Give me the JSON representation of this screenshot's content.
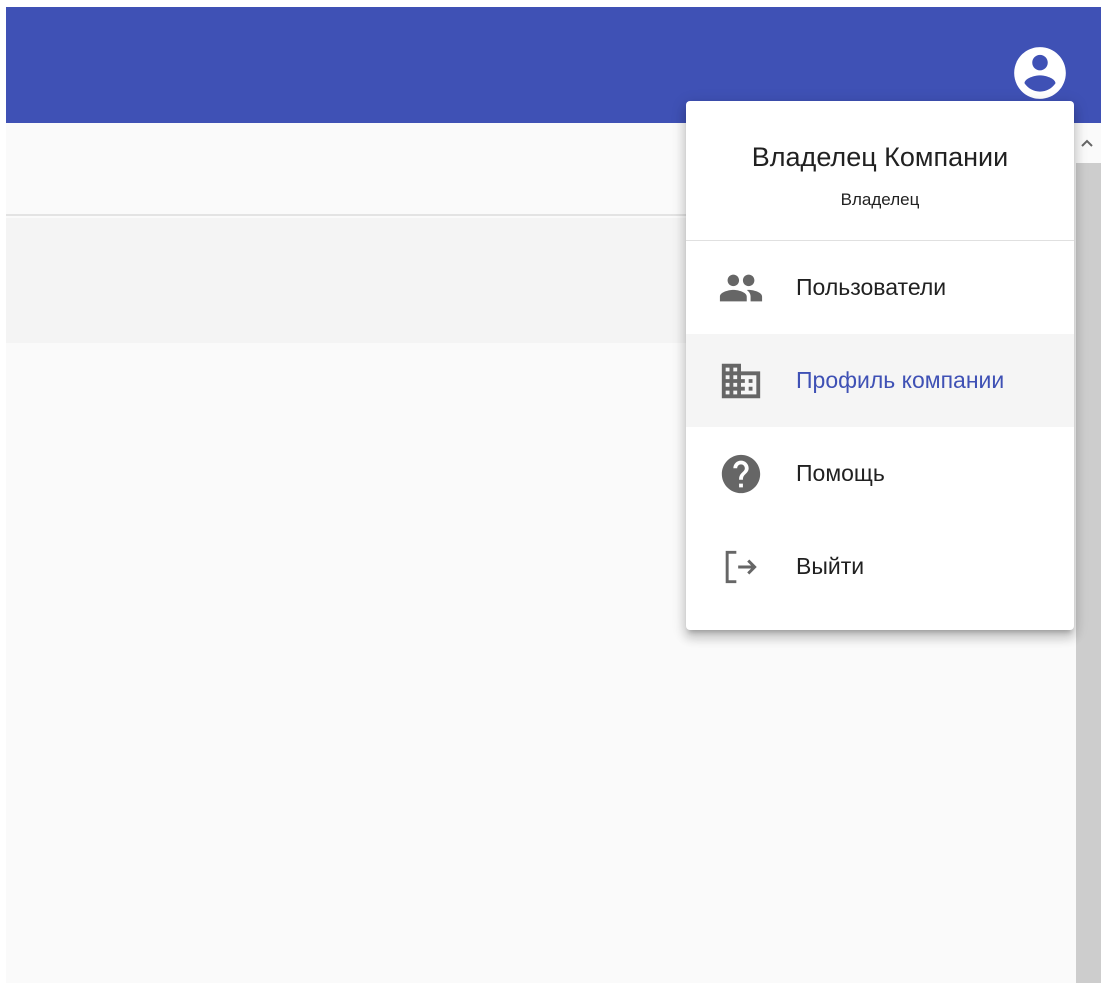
{
  "app_bar": {
    "color": "#3f51b5",
    "account_icon": "account-circle-icon"
  },
  "user_menu": {
    "user_name": "Владелец Компании",
    "user_role": "Владелец",
    "items": [
      {
        "label": "Пользователи",
        "icon": "people-icon",
        "active": false
      },
      {
        "label": "Профиль компании",
        "icon": "business-icon",
        "active": true
      },
      {
        "label": "Помощь",
        "icon": "help-icon",
        "active": false
      },
      {
        "label": "Выйти",
        "icon": "logout-icon",
        "active": false
      }
    ]
  },
  "colors": {
    "accent": "#3f51b5",
    "icon_gray": "#666666"
  }
}
